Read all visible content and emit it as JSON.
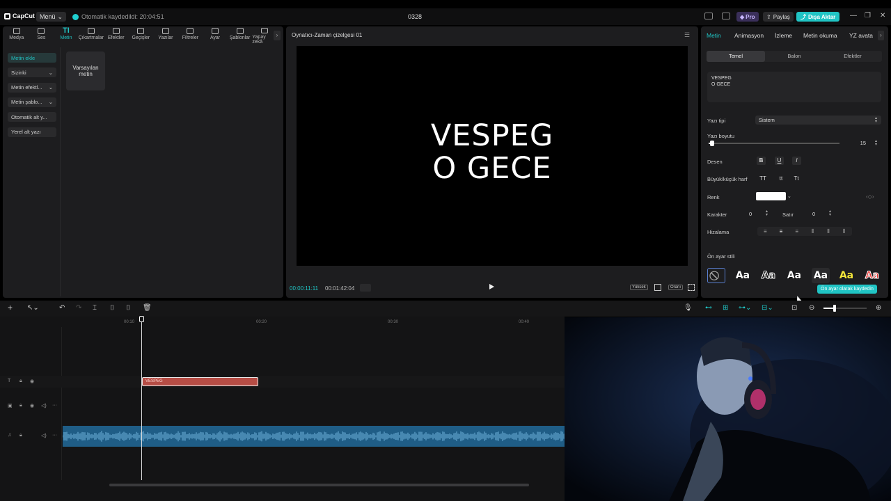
{
  "app": {
    "logo": "CapCut",
    "menu_label": "Menü",
    "autosave": "Otomatik kaydedildi: 20:04:51",
    "project_title": "0328",
    "pro_label": "Pro",
    "share_label": "Paylaş",
    "export_label": "Dışa Aktar"
  },
  "toolbar": [
    {
      "label": "Medya",
      "icon": "media-icon"
    },
    {
      "label": "Ses",
      "icon": "audio-icon"
    },
    {
      "label": "Metin",
      "icon": "text-icon",
      "active": true
    },
    {
      "label": "Çıkartmalar",
      "icon": "sticker-icon"
    },
    {
      "label": "Efektler",
      "icon": "effects-icon"
    },
    {
      "label": "Geçişler",
      "icon": "transitions-icon"
    },
    {
      "label": "Yazılar",
      "icon": "captions-icon"
    },
    {
      "label": "Filtreler",
      "icon": "filters-icon"
    },
    {
      "label": "Ayar",
      "icon": "adjust-icon"
    },
    {
      "label": "Şablonlar",
      "icon": "templates-icon"
    },
    {
      "label": "Yapay zekâ",
      "icon": "ai-icon"
    }
  ],
  "side_nav": [
    {
      "label": "Metin ekle",
      "active": true,
      "dropdown": false
    },
    {
      "label": "Sizinki",
      "dropdown": true
    },
    {
      "label": "Metin efektl...",
      "dropdown": true
    },
    {
      "label": "Metin şablo...",
      "dropdown": true
    },
    {
      "label": "Otomatik alt y...",
      "dropdown": false
    },
    {
      "label": "Yerel alt yazı",
      "dropdown": false
    }
  ],
  "default_text_card": "Varsayılan metin",
  "player": {
    "title": "Oynatıcı-Zaman çizelgesi 01",
    "video_text": "VESPEG\nO GECE",
    "current_time": "00:00:11:11",
    "total_time": "00:01:42:04",
    "quality_label": "Yüksek",
    "ratio_label": "Oranı"
  },
  "right_panel": {
    "tabs": [
      "Metin",
      "Animasyon",
      "İzleme",
      "Metin okuma",
      "YZ avata"
    ],
    "active_tab": "Metin",
    "subtabs": [
      "Temel",
      "Balon",
      "Efektler"
    ],
    "text_value": "VESPEG\nO GECE",
    "font_label": "Yazı tipi",
    "font_value": "Sistem",
    "size_label": "Yazı boyutu",
    "size_value": "15",
    "pattern_label": "Desen",
    "pattern_buttons": [
      "B",
      "U",
      "I"
    ],
    "case_label": "Büyük/küçük harf",
    "case_buttons": [
      "TT",
      "tt",
      "Tt"
    ],
    "color_label": "Renk",
    "color_value": "#ffffff",
    "char_label": "Karakter",
    "char_value": "0",
    "line_label": "Satır",
    "line_value": "0",
    "align_label": "Hizalama",
    "preset_label": "Ön ayar stili",
    "preset_text": "Aa",
    "toast": "Ön ayar olarak kaydedin"
  },
  "timeline": {
    "ruler": [
      "00:10",
      "00:20",
      "00:30",
      "00:40"
    ],
    "clip_label": "VESPEG"
  },
  "colors": {
    "accent": "#20c4c4",
    "clip": "#b64d45",
    "audio": "#1f5d86"
  }
}
